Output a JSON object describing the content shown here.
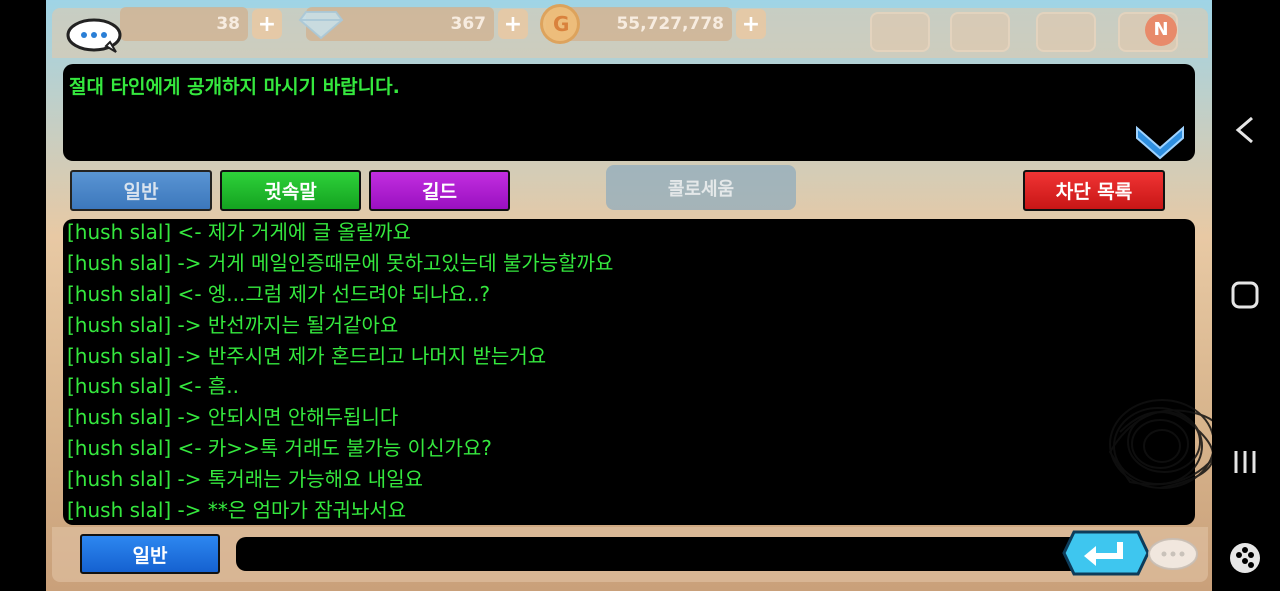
{
  "resources": {
    "stamina": "38",
    "gems": "367",
    "gold": "55,727,778",
    "plus_glyph": "+"
  },
  "notification_badge": "N",
  "background_sign": "콜로세움",
  "notice": {
    "text": "절대 타인에게 공개하지 마시기 바랍니다."
  },
  "tabs": {
    "general": "일반",
    "whisper": "귓속말",
    "guild": "길드",
    "block_list": "차단 목록"
  },
  "chat_log": [
    "[hush slal] <- 제가 거게에 글 올릴까요",
    "[hush slal] -> 거게 메일인증때문에 못하고있는데 불가능할까요",
    "[hush slal] <- 엥...그럼 제가 선드려야 되나요..?",
    "[hush slal] -> 반선까지는 될거같아요",
    "[hush slal] -> 반주시면 제가 혼드리고 나머지 받는거요",
    "[hush slal] <- 흠..",
    "[hush slal] -> 안되시면 안해두됩니다",
    "[hush slal] <- 카>>톡 거래도 불가능 이신가요?",
    "[hush slal] -> 톡거래는 가능해요 내일요",
    "[hush slal] -> **은 엄마가 잠궈놔서요"
  ],
  "input": {
    "mode_label": "일반",
    "value": "",
    "placeholder": ""
  },
  "colors": {
    "chat_text": "#35e83e",
    "tab_general": "#2b6fbf",
    "tab_whisper": "#14a320",
    "tab_guild": "#9a10c0",
    "tab_block": "#c81616",
    "send_button": "#3ec6ef"
  },
  "icons": {
    "chat": "chat-bubble-icon",
    "collapse": "chevron-down-icon",
    "send": "enter-arrow-icon",
    "emoji": "speech-bubble-icon",
    "mail": "mail-icon",
    "house": "house-icon",
    "friends": "heart-badge-icon",
    "quests": "list-icon",
    "nav_back": "back-icon",
    "nav_home": "home-icon",
    "nav_recent": "recent-apps-icon",
    "nav_game": "gamepad-icon"
  }
}
